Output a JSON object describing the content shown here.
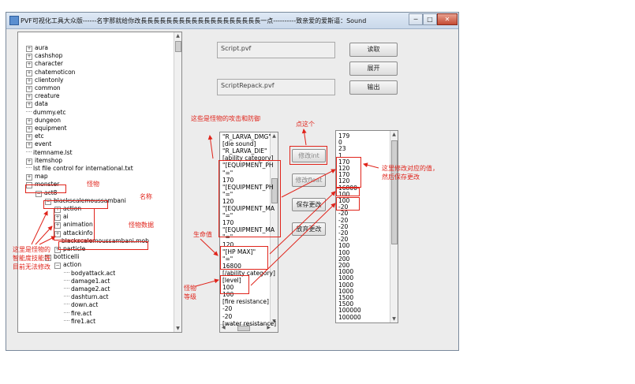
{
  "window": {
    "title": "PVF可视化工具大众版------名字那就给你改長長長長長長長長長長長長長長長長長長長一点----------致亲爱的爱斯逼：Sound",
    "controls": [
      "─",
      "□",
      "✕"
    ]
  },
  "tree": {
    "items": [
      {
        "label": "aura",
        "exp": "+"
      },
      {
        "label": "cashshop",
        "exp": "+"
      },
      {
        "label": "character",
        "exp": "+"
      },
      {
        "label": "chatemoticon",
        "exp": "+"
      },
      {
        "label": "clientonly",
        "exp": "+"
      },
      {
        "label": "common",
        "exp": "+"
      },
      {
        "label": "creature",
        "exp": "+"
      },
      {
        "label": "data",
        "exp": "+"
      },
      {
        "label": "dummy.etc",
        "exp": ""
      },
      {
        "label": "dungeon",
        "exp": "+"
      },
      {
        "label": "equipment",
        "exp": "+"
      },
      {
        "label": "etc",
        "exp": "+"
      },
      {
        "label": "event",
        "exp": "+"
      },
      {
        "label": "itemname.lst",
        "exp": ""
      },
      {
        "label": "itemshop",
        "exp": "+"
      },
      {
        "label": "lst file control for international.txt",
        "exp": ""
      },
      {
        "label": "map",
        "exp": "+"
      },
      {
        "label": "monster",
        "exp": "-"
      },
      {
        "label": "act8",
        "exp": "-"
      },
      {
        "label": "blackscalemoussambani",
        "exp": "-"
      },
      {
        "label": "action",
        "exp": "+"
      },
      {
        "label": "ai",
        "exp": "+"
      },
      {
        "label": "animation",
        "exp": "+"
      },
      {
        "label": "attackinfo",
        "exp": "+"
      },
      {
        "label": "blackscalemoussambani.mob",
        "exp": ""
      },
      {
        "label": "particle",
        "exp": "+"
      },
      {
        "label": "botticelli",
        "exp": "-"
      },
      {
        "label": "action",
        "exp": "-"
      },
      {
        "label": "bodyattack.act",
        "exp": ""
      },
      {
        "label": "damage1.act",
        "exp": ""
      },
      {
        "label": "damage2.act",
        "exp": ""
      },
      {
        "label": "dashturn.act",
        "exp": ""
      },
      {
        "label": "down.act",
        "exp": ""
      },
      {
        "label": "fire.act",
        "exp": ""
      },
      {
        "label": "fire1.act",
        "exp": ""
      }
    ]
  },
  "fields": {
    "script": "Script.pvf",
    "repack": "ScriptRepack.pvf"
  },
  "buttons": {
    "read": "读取",
    "expand": "展开",
    "export": "输出",
    "modify_int": "修改int",
    "modify_float": "修改float",
    "save": "保存更改",
    "discard": "放弃更改"
  },
  "script_lines": [
    "\"R_LARVA_DMG\"",
    "[die sound]",
    "\"R_LARVA_DIE\"",
    "[ability category]",
    "\"[EQUIPMENT_PH",
    "\"=\"",
    "170",
    "\"[EQUIPMENT_PH",
    "\"=\"",
    "120",
    "\"[EQUIPMENT_MA",
    "\"=\"",
    "170",
    "\"[EQUIPMENT_MA",
    "\"=\"",
    "120",
    "\"[HP MAX]\"",
    "\"=\"",
    "16800",
    "[/ability category]",
    "[level]",
    "100",
    "100",
    "[fire resistance]",
    "-20",
    "-20",
    "[water resistance]"
  ],
  "value_lines": [
    "179",
    "0",
    "23",
    "1",
    "170",
    "120",
    "170",
    "120",
    "16800",
    "100",
    "100",
    "-20",
    "-20",
    "-20",
    "-20",
    "-20",
    "-20",
    "100",
    "100",
    "200",
    "200",
    "1000",
    "1000",
    "1000",
    "1000",
    "1500",
    "1500",
    "100000",
    "100000"
  ],
  "annotations": {
    "attack_defense": "这些是怪物的攻击和防御",
    "click_this": "点这个",
    "modify_note_1": "这里修改对应的值，",
    "modify_note_2": "然后保存更改",
    "monster": "怪物",
    "name": "名称",
    "monster_data": "怪物数据",
    "hp": "生命值",
    "level_1": "怪物",
    "level_2": "等级",
    "ai_note_1": "这里是怪物的",
    "ai_note_2": "智能度技能等",
    "ai_note_3": "目前无法修改"
  },
  "colors": {
    "annotation": "#e0241b",
    "window_bg": "#ececec"
  }
}
